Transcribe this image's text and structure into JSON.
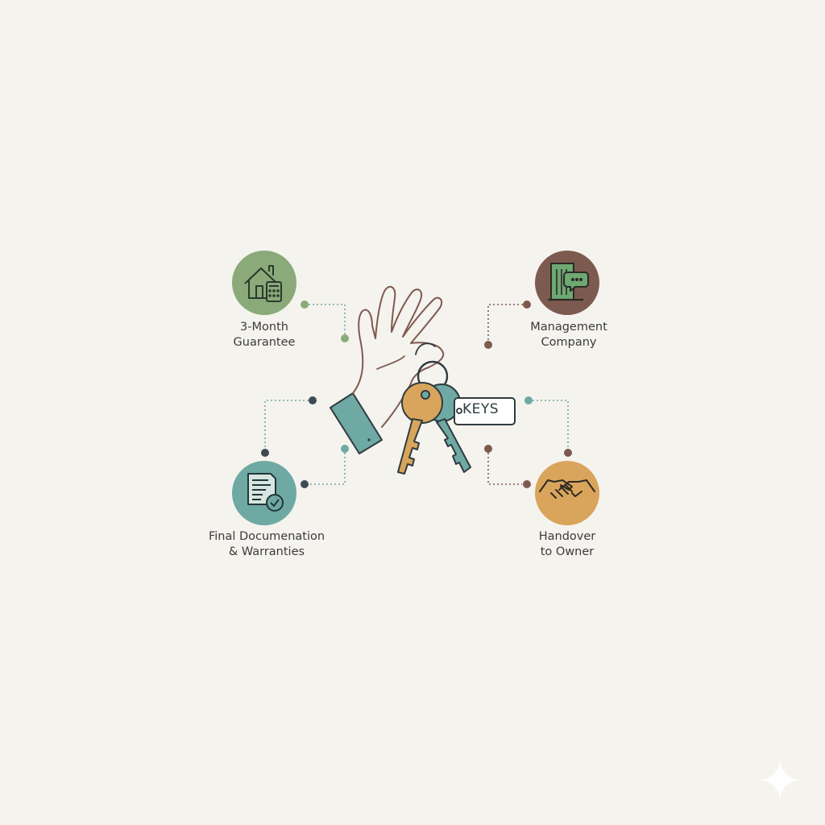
{
  "nodes": {
    "guarantee": {
      "line1": "3-Month",
      "line2": "Guarantee",
      "color": "#8aaa7a",
      "icon": "house-calculator-icon"
    },
    "management": {
      "line1": "Management",
      "line2": "Company",
      "color": "#7d5a4f",
      "icon": "building-chat-icon"
    },
    "docs": {
      "line1": "Final Documenation",
      "line2": "& Warranties",
      "color": "#6fa9a3",
      "icon": "document-check-icon"
    },
    "handover": {
      "line1": "Handover",
      "line2": "to Owner",
      "color": "#d9a55c",
      "icon": "handshake-icon"
    }
  },
  "center": {
    "tag_label": "KEYS",
    "icon": "hand-holding-keys-icon"
  },
  "colors": {
    "background": "#f5f3ee",
    "line_dark": "#3d3d3d",
    "teal": "#6fa9a3",
    "brown": "#7d5a4f",
    "green": "#8aaa7a",
    "gold": "#d9a55c"
  }
}
